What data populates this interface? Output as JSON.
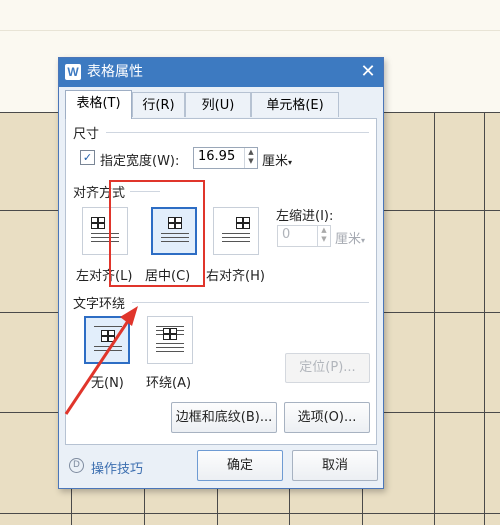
{
  "dialog": {
    "logo": "W",
    "title": "表格属性",
    "close_glyph": "✕",
    "tabs": [
      "表格(T)",
      "行(R)",
      "列(U)",
      "单元格(E)"
    ],
    "size": {
      "section": "尺寸",
      "specify_width_label": "指定宽度(W):",
      "width_value": "16.95",
      "unit": "厘米",
      "checked": true
    },
    "alignment": {
      "section": "对齐方式",
      "options": [
        "左对齐(L)",
        "居中(C)",
        "右对齐(H)"
      ],
      "selected": "居中(C)",
      "indent_label": "左缩进(I):",
      "indent_value": "0",
      "indent_unit": "厘米"
    },
    "wrapping": {
      "section": "文字环绕",
      "options": [
        "无(N)",
        "环绕(A)"
      ],
      "selected": "无(N)",
      "position_button": "定位(P)..."
    },
    "borders_button": "边框和底纹(B)...",
    "options_button": "选项(O)...",
    "help_label": "操作技巧",
    "ok_button": "确定",
    "cancel_button": "取消"
  },
  "colors": {
    "titlebar": "#3d7ac1",
    "annotation": "#e0352b",
    "grid_background": "#e9dec3"
  }
}
